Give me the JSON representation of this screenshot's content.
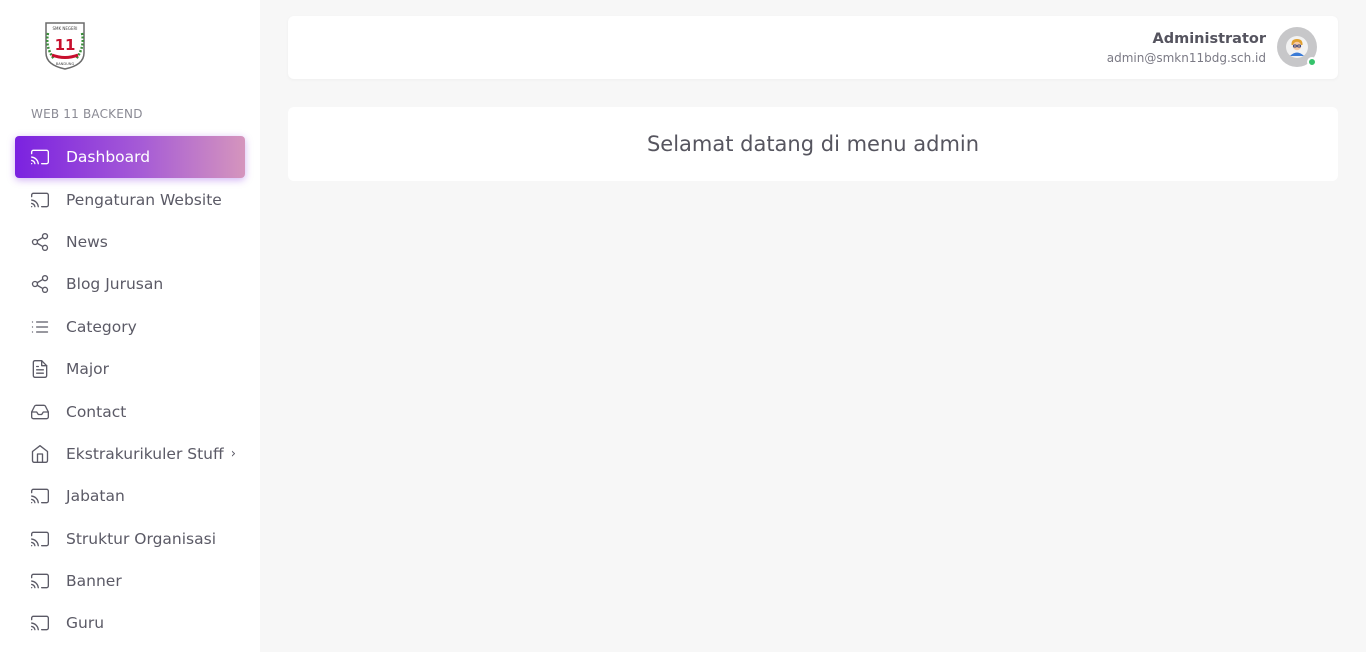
{
  "sidebar": {
    "logo": {
      "icon": "school-logo",
      "text_top": "SMK NEGERI",
      "number": "11",
      "text_bottom": "BANDUNG"
    },
    "section_label": "WEB 11 BACKEND",
    "items": [
      {
        "label": "Dashboard",
        "icon": "cast-icon",
        "active": true
      },
      {
        "label": "Pengaturan Website",
        "icon": "cast-icon"
      },
      {
        "label": "News",
        "icon": "share-icon"
      },
      {
        "label": "Blog Jurusan",
        "icon": "share-icon"
      },
      {
        "label": "Category",
        "icon": "list-icon"
      },
      {
        "label": "Major",
        "icon": "file-text-icon"
      },
      {
        "label": "Contact",
        "icon": "inbox-icon"
      },
      {
        "label": "Ekstrakurikuler Stuff",
        "icon": "home-icon",
        "has_submenu": true
      },
      {
        "label": "Jabatan",
        "icon": "cast-icon"
      },
      {
        "label": "Struktur Organisasi",
        "icon": "cast-icon"
      },
      {
        "label": "Banner",
        "icon": "cast-icon"
      },
      {
        "label": "Guru",
        "icon": "cast-icon"
      }
    ],
    "submenu_chevron": "›"
  },
  "header": {
    "user_name": "Administrator",
    "user_email": "admin@smkn11bdg.sch.id",
    "avatar_icon": "user-avatar-icon",
    "status": "online"
  },
  "main": {
    "welcome": "Selamat datang di menu admin"
  },
  "colors": {
    "accent_start": "#7b22e0",
    "accent_end": "#d595bd",
    "background": "#f7f7f7",
    "online": "#35c36b"
  }
}
